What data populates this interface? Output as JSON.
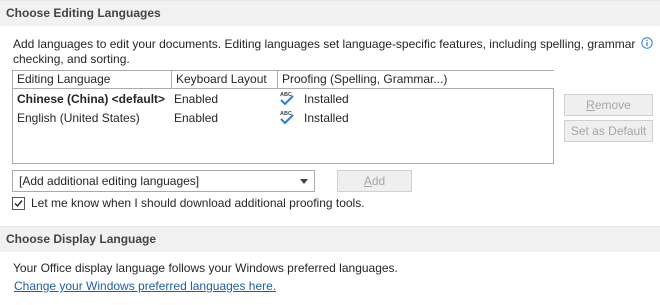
{
  "editing_section": {
    "header": "Choose Editing Languages",
    "description": "Add languages to edit your documents. Editing languages set language-specific features, including spelling, grammar checking, and sorting.",
    "info_icon": "info-icon",
    "table": {
      "columns": [
        "Editing Language",
        "Keyboard Layout",
        "Proofing (Spelling, Grammar...)"
      ],
      "rows": [
        {
          "language": "Chinese (China) <default>",
          "keyboard": "Enabled",
          "proofing_icon": "abc-check-icon",
          "proofing": "Installed",
          "bold": true
        },
        {
          "language": "English (United States)",
          "keyboard": "Enabled",
          "proofing_icon": "abc-check-icon",
          "proofing": "Installed",
          "bold": false
        }
      ]
    },
    "remove_label": "Remove",
    "set_default_label": "Set as Default",
    "add_dropdown_value": "[Add additional editing languages]",
    "add_label": "Add",
    "checkbox_label": "Let me know when I should download additional proofing tools.",
    "checkbox_checked": true
  },
  "display_section": {
    "header": "Choose Display Language",
    "text": "Your Office display language follows your Windows preferred languages.",
    "link": "Change your Windows preferred languages here."
  },
  "colors": {
    "header_bg": "#f1f1f1",
    "link": "#1e5fa8",
    "check_blue": "#2b7cd3",
    "disabled_text": "#a6a6a6"
  }
}
